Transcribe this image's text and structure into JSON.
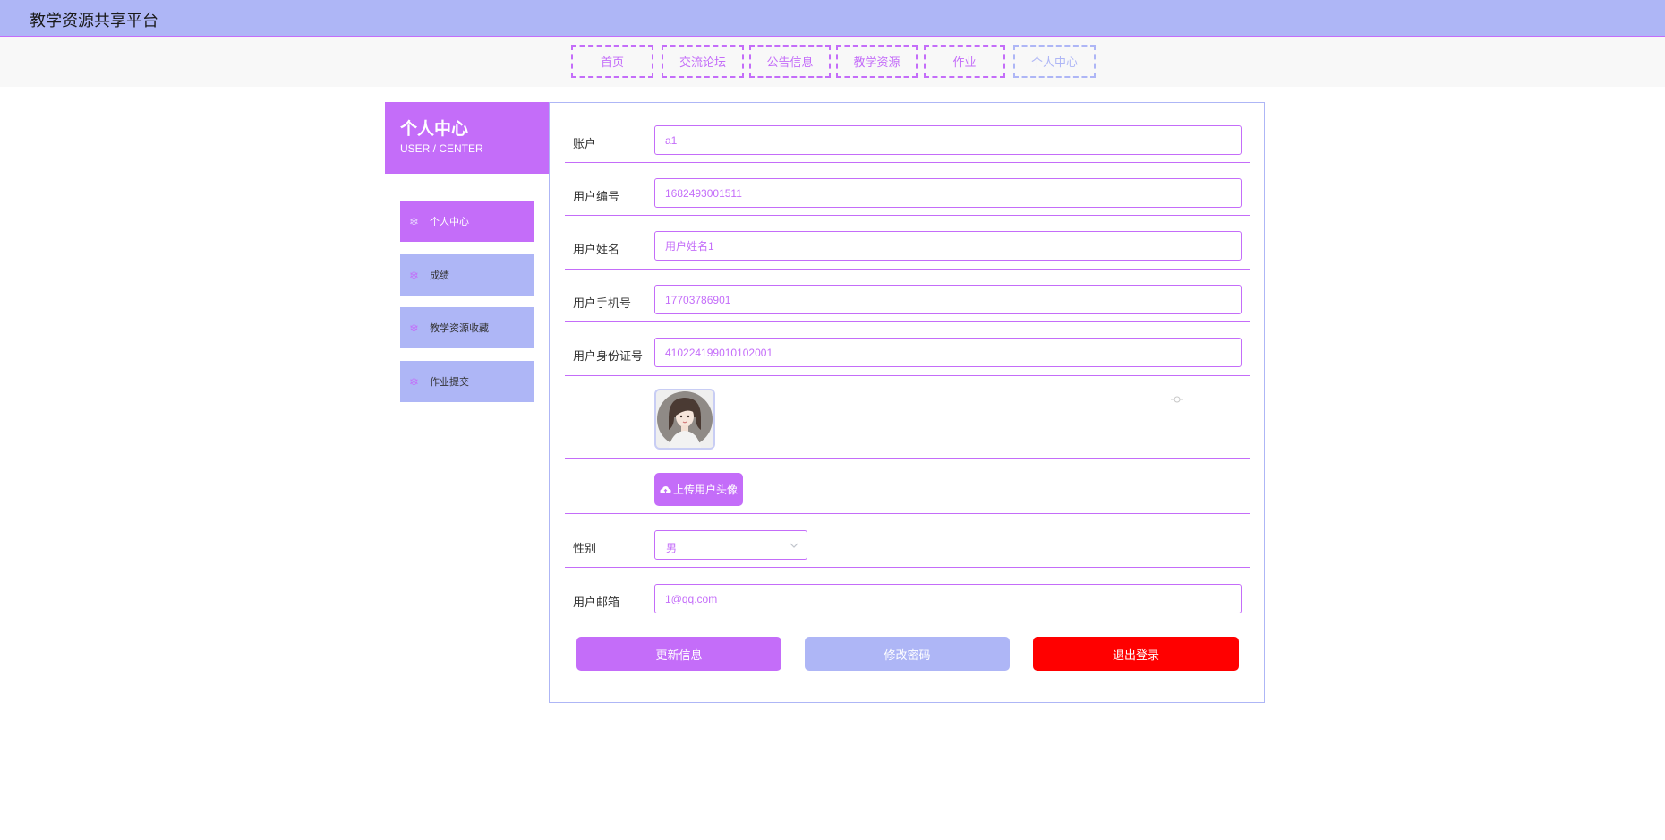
{
  "app": {
    "title": "教学资源共享平台"
  },
  "nav": {
    "items": [
      {
        "label": "首页",
        "active": false
      },
      {
        "label": "交流论坛",
        "active": false
      },
      {
        "label": "公告信息",
        "active": false
      },
      {
        "label": "教学资源",
        "active": false
      },
      {
        "label": "作业",
        "active": false
      },
      {
        "label": "个人中心",
        "active": true
      }
    ]
  },
  "sidebar": {
    "title": "个人中心",
    "subtitle": "USER / CENTER",
    "icon": "snowflake-icon",
    "items": [
      {
        "label": "个人中心",
        "active": true
      },
      {
        "label": "成绩",
        "active": false
      },
      {
        "label": "教学资源收藏",
        "active": false
      },
      {
        "label": "作业提交",
        "active": false
      }
    ]
  },
  "form": {
    "account": {
      "label": "账户",
      "value": "a1"
    },
    "user_no": {
      "label": "用户编号",
      "value": "1682493001511"
    },
    "user_name": {
      "label": "用户姓名",
      "value": "用户姓名1"
    },
    "phone": {
      "label": "用户手机号",
      "value": "17703786901"
    },
    "id_card": {
      "label": "用户身份证号",
      "value": "410224199010102001"
    },
    "avatar": {
      "icon": "user-avatar-image"
    },
    "upload": {
      "label": "上传用户头像",
      "icon": "cloud-upload-icon"
    },
    "gender": {
      "label": "性别",
      "value": "男"
    },
    "email": {
      "label": "用户邮箱",
      "value": "1@qq.com"
    }
  },
  "actions": {
    "update": "更新信息",
    "change_password": "修改密码",
    "logout": "退出登录"
  },
  "colors": {
    "primary": "#c46df9",
    "secondary": "#aeb6f6",
    "danger": "#ff0000"
  }
}
